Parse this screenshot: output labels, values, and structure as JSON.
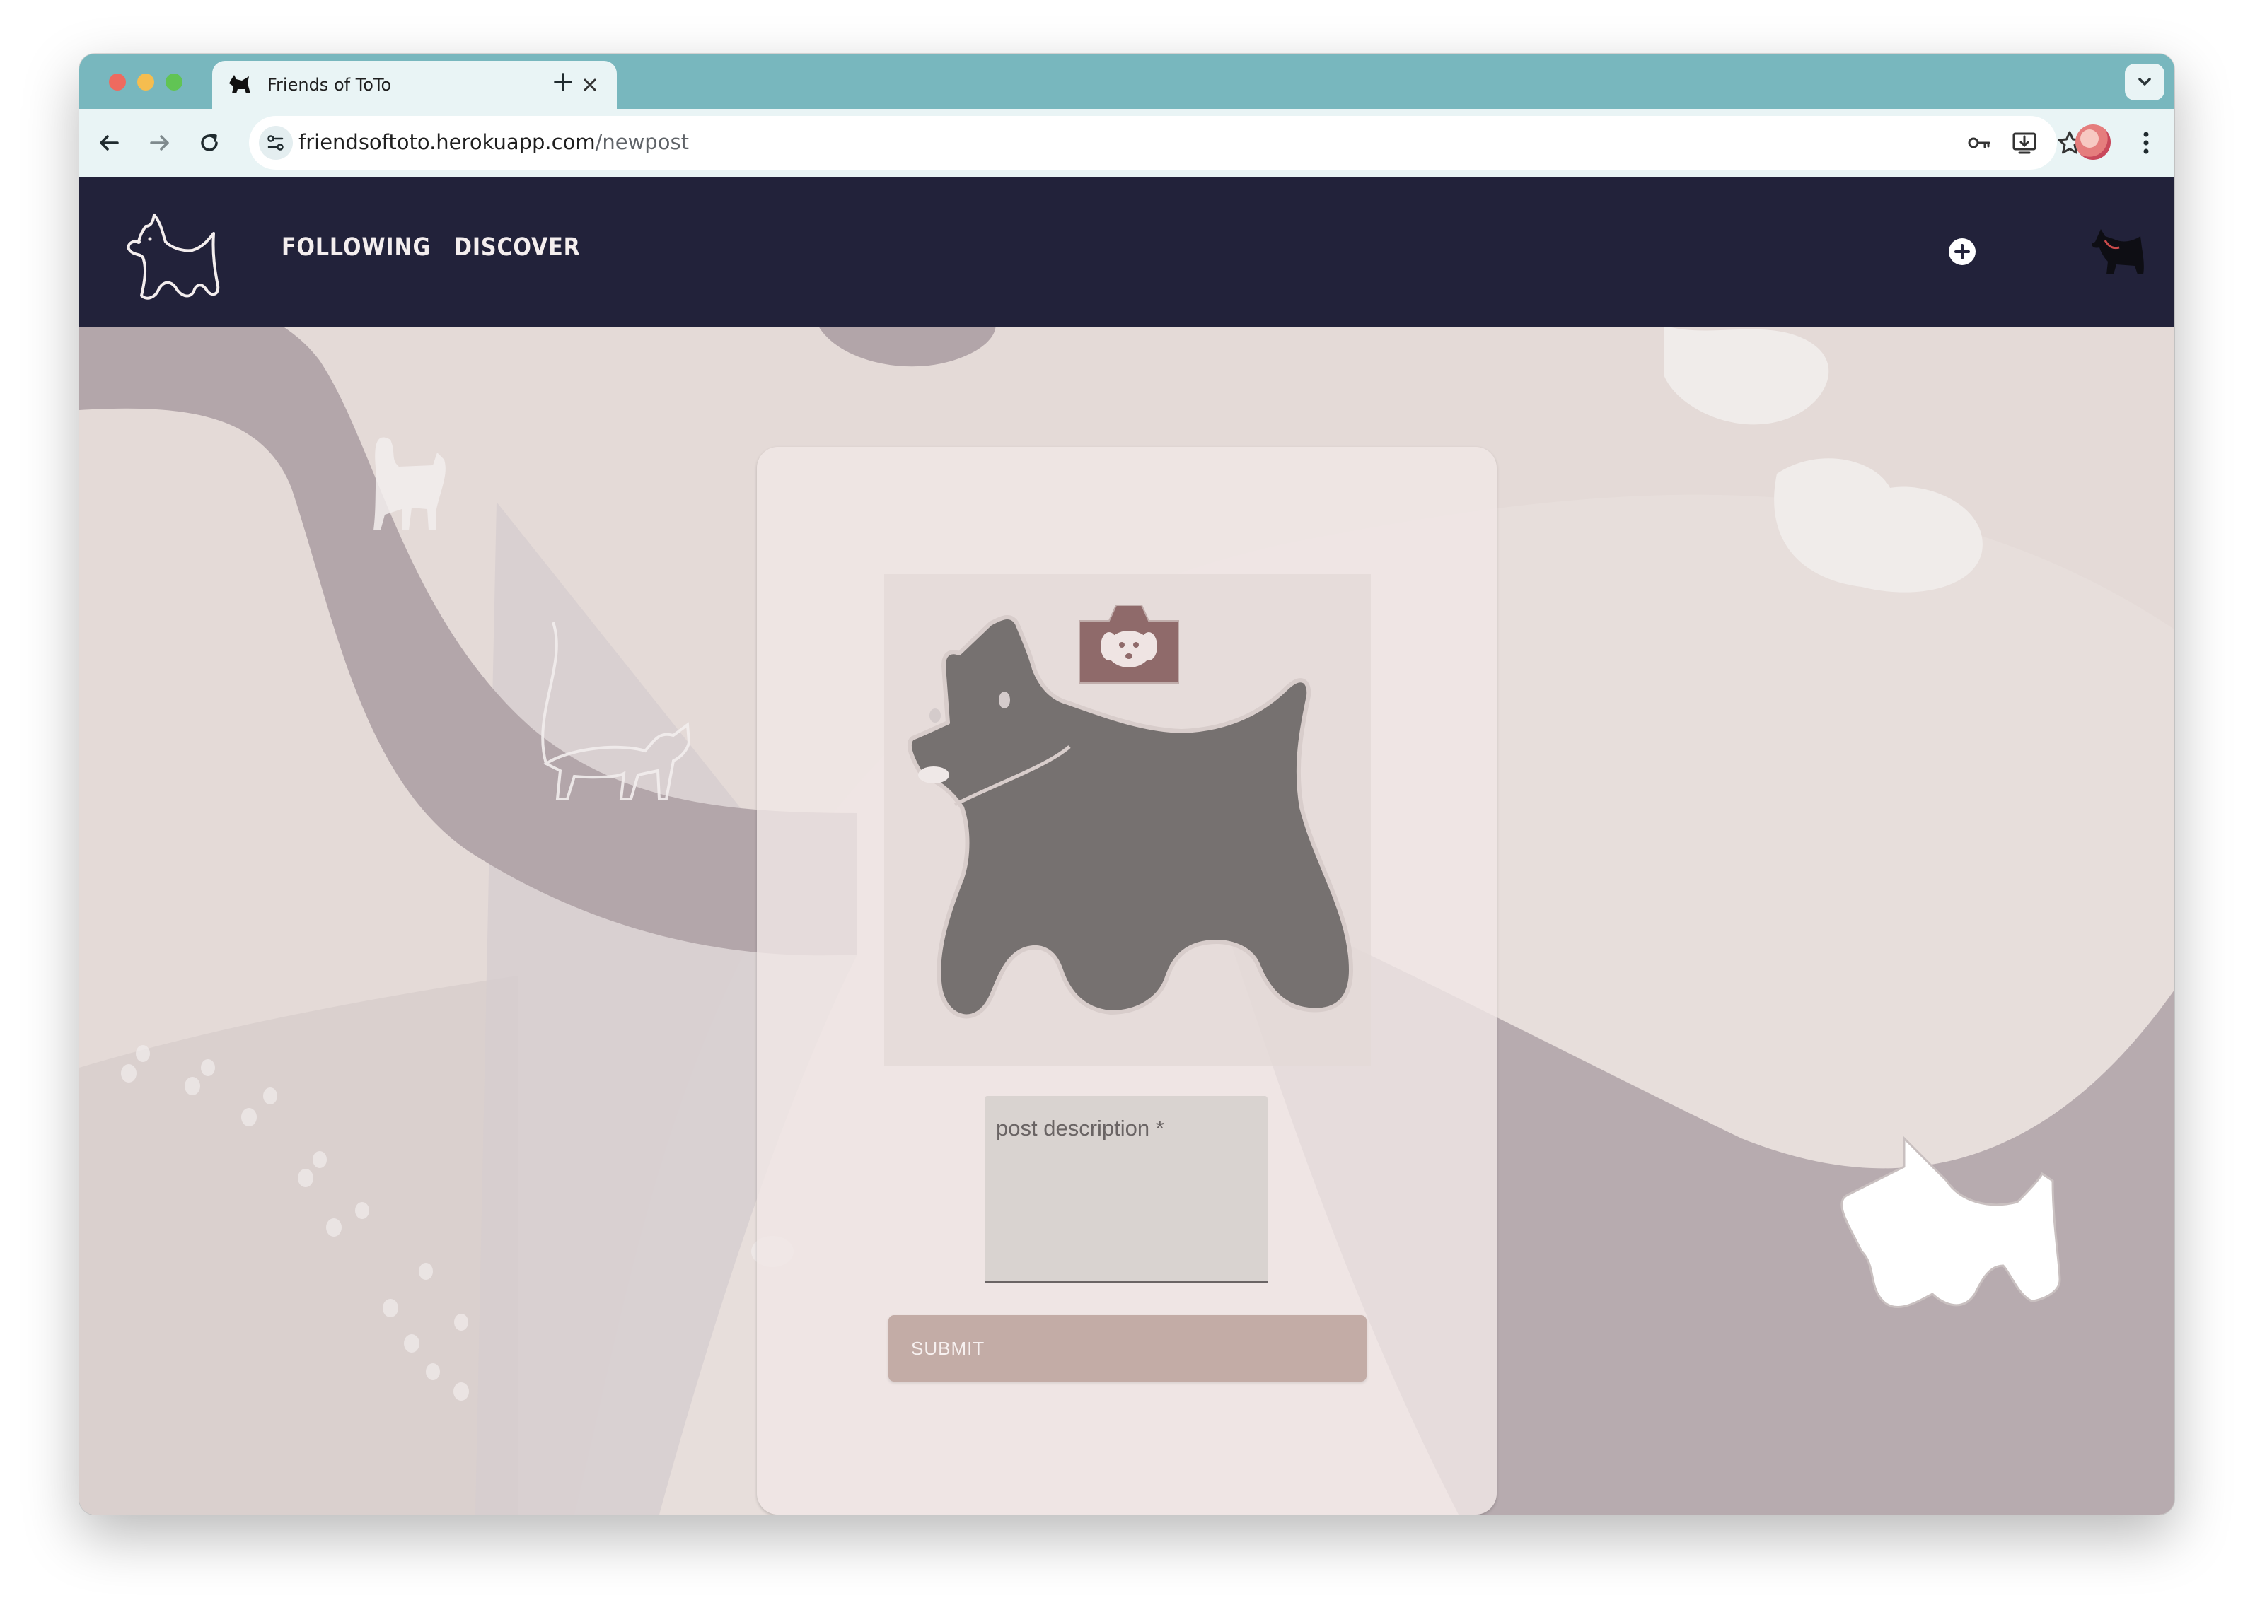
{
  "browser": {
    "tab_title": "Friends of ToTo",
    "url_domain": "friendsoftoto.herokuapp.com",
    "url_path": "/newpost"
  },
  "nav": {
    "following_label": "FOLLOWING",
    "discover_label": "DISCOVER"
  },
  "form": {
    "description_placeholder": "post description *",
    "submit_label": "SUBMIT"
  },
  "colors": {
    "tabstrip": "#78b7be",
    "appbar": "#22223a",
    "card": "#f0e6e5",
    "submit": "#c3aca6",
    "camera_badge": "#8f6a6a"
  },
  "icons": [
    "terrier-favicon-icon",
    "close-icon",
    "plus-icon",
    "back-arrow-icon",
    "forward-arrow-icon",
    "reload-icon",
    "site-settings-icon",
    "key-icon",
    "install-icon",
    "star-icon",
    "kebab-menu-icon",
    "add-circle-icon",
    "camera-icon"
  ]
}
